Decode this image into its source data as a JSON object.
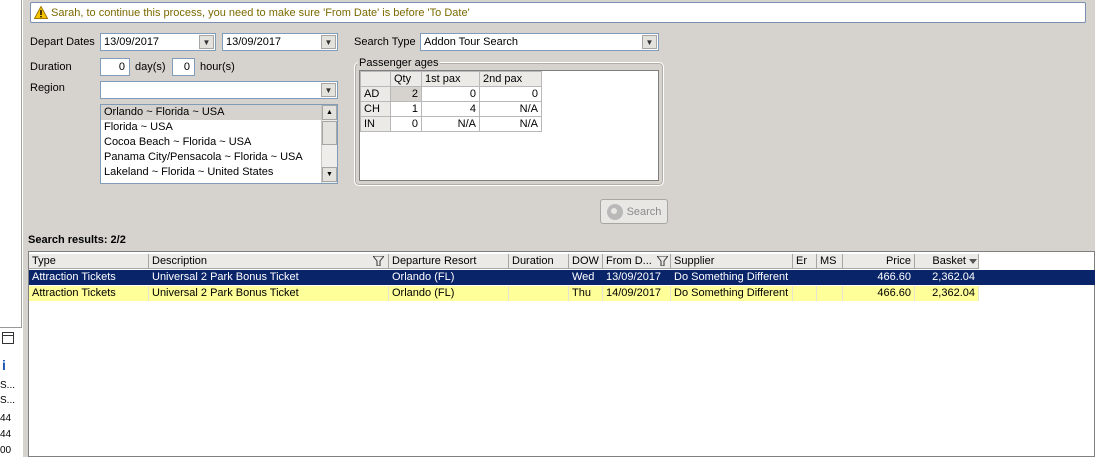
{
  "warning": {
    "text": "Sarah, to continue this process, you need to make sure 'From Date' is before 'To Date'"
  },
  "form": {
    "depart_label": "Depart Dates",
    "depart_from": "13/09/2017",
    "depart_to": "13/09/2017",
    "duration_label": "Duration",
    "duration_days": "0",
    "days_unit": "day(s)",
    "duration_hours": "0",
    "hours_unit": "hour(s)",
    "region_label": "Region",
    "region_value": "",
    "region_list": [
      "Orlando ~ Florida ~ USA",
      "Florida ~ USA",
      "Cocoa Beach ~ Florida ~ USA",
      "Panama City/Pensacola ~  Florida  ~ USA",
      "Lakeland ~ Florida ~ United States"
    ],
    "search_type_label": "Search Type",
    "search_type_value": "Addon Tour Search",
    "search_button": "Search"
  },
  "passengers": {
    "title": "Passenger ages",
    "headers": [
      "",
      "Qty",
      "1st pax",
      "2nd pax"
    ],
    "rows": [
      [
        "AD",
        "2",
        "0",
        "0"
      ],
      [
        "CH",
        "1",
        "4",
        "N/A"
      ],
      [
        "IN",
        "0",
        "N/A",
        "N/A"
      ]
    ]
  },
  "results": {
    "label": "Search results: 2/2",
    "columns": [
      "Type",
      "Description",
      "Departure Resort",
      "Duration",
      "DOW",
      "From D...",
      "Supplier",
      "Er",
      "MS",
      "Price",
      "Basket"
    ],
    "rows": [
      [
        "Attraction Tickets",
        "Universal 2 Park Bonus Ticket",
        "Orlando (FL)",
        "",
        "Wed",
        "13/09/2017",
        "Do Something Different",
        "",
        "",
        "466.60",
        "2,362.04"
      ],
      [
        "Attraction Tickets",
        "Universal 2 Park Bonus Ticket",
        "Orlando (FL)",
        "",
        "Thu",
        "14/09/2017",
        "Do Something Different",
        "",
        "",
        "466.60",
        "2,362.04"
      ]
    ]
  },
  "left_fragments": [
    "S...",
    "S...",
    "44",
    "44",
    "00"
  ],
  "colors": {
    "selection": "#0a246a",
    "highlight_row": "#ffff99",
    "panel": "#d6d3ce"
  }
}
